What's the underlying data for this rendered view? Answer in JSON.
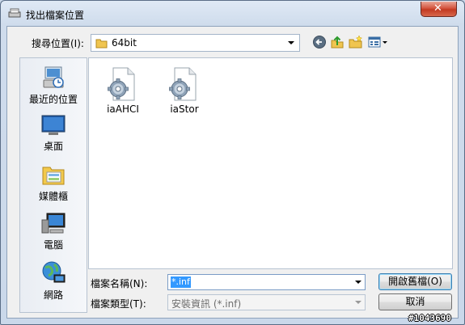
{
  "window": {
    "title": "找出檔案位置",
    "close_glyph": "✕"
  },
  "lookin": {
    "label": "搜尋位置(I):",
    "value": "64bit"
  },
  "toolbar": {
    "back_icon": "back-arrow-icon",
    "up_icon": "up-folder-icon",
    "new_folder_icon": "new-folder-icon",
    "view_icon": "view-menu-icon"
  },
  "places": [
    {
      "label": "最近的位置",
      "icon": "recent-places-icon"
    },
    {
      "label": "桌面",
      "icon": "desktop-icon"
    },
    {
      "label": "媒體櫃",
      "icon": "libraries-icon"
    },
    {
      "label": "電腦",
      "icon": "computer-icon"
    },
    {
      "label": "網路",
      "icon": "network-icon"
    }
  ],
  "files": [
    {
      "name": "iaAHCI",
      "icon": "setup-information-file-icon"
    },
    {
      "name": "iaStor",
      "icon": "setup-information-file-icon"
    }
  ],
  "filename": {
    "label": "檔案名稱(N):",
    "value": "*.inf"
  },
  "filetype": {
    "label": "檔案類型(T):",
    "value": "安裝資訊 (*.inf)"
  },
  "buttons": {
    "open": "開啟舊檔(O)",
    "cancel": "取消"
  },
  "watermark": "#1043690",
  "colors": {
    "selection": "#3399ff",
    "close_button": "#c9452d",
    "title_gradient": "#dfe9f5"
  }
}
